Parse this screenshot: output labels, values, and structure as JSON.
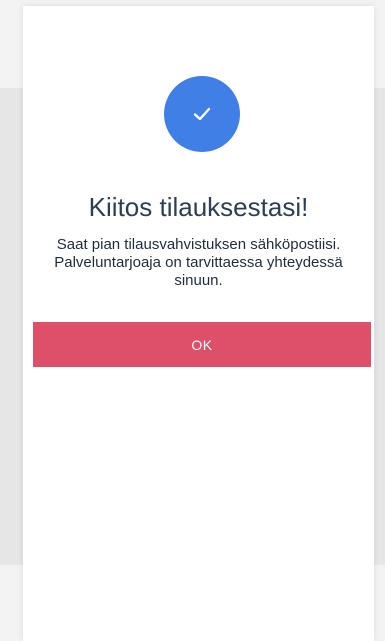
{
  "modal": {
    "icon": "check-icon",
    "title": "Kiitos tilauksestasi!",
    "message": "Saat pian tilausvahvistuksen sähköpostiisi. Palveluntarjoaja on tarvittaessa yhteydessä sinuun.",
    "ok_label": "OK"
  },
  "colors": {
    "accent_blue": "#3f7fe6",
    "button_red": "#de506a",
    "title_text": "#2e3f52"
  }
}
